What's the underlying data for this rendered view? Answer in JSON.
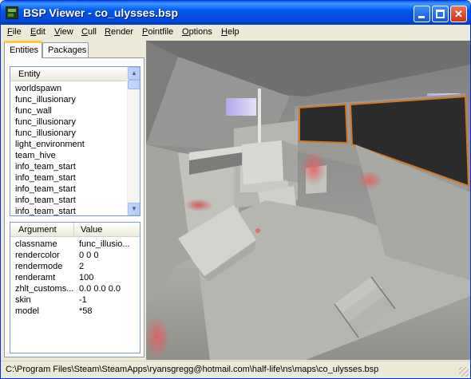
{
  "window": {
    "title": "BSP Viewer - co_ulysses.bsp",
    "controls": {
      "minimize": "minimize",
      "maximize": "maximize",
      "close": "✕"
    }
  },
  "menu": [
    {
      "u": "F",
      "rest": "ile"
    },
    {
      "u": "E",
      "rest": "dit"
    },
    {
      "u": "V",
      "rest": "iew"
    },
    {
      "u": "C",
      "rest": "ull"
    },
    {
      "u": "R",
      "rest": "ender"
    },
    {
      "u": "P",
      "rest": "ointfile"
    },
    {
      "u": "O",
      "rest": "ptions"
    },
    {
      "u": "H",
      "rest": "elp"
    }
  ],
  "tabs": {
    "entities": "Entities",
    "packages": "Packages"
  },
  "entity_list": {
    "header": "Entity",
    "items": [
      "worldspawn",
      "func_illusionary",
      "func_wall",
      "func_illusionary",
      "func_illusionary",
      "light_environment",
      "team_hive",
      "info_team_start",
      "info_team_start",
      "info_team_start",
      "info_team_start",
      "info_team_start"
    ]
  },
  "properties": {
    "headers": {
      "argument": "Argument",
      "value": "Value"
    },
    "rows": [
      {
        "arg": "classname",
        "val": "func_illusio..."
      },
      {
        "arg": "rendercolor",
        "val": "0 0 0"
      },
      {
        "arg": "rendermode",
        "val": "2"
      },
      {
        "arg": "renderamt",
        "val": "100"
      },
      {
        "arg": "zhlt_customs...",
        "val": "0.0 0.0 0.0"
      },
      {
        "arg": "skin",
        "val": "-1"
      },
      {
        "arg": "model",
        "val": "*58"
      }
    ]
  },
  "status": "C:\\Program Files\\Steam\\SteamApps\\ryansgregg@hotmail.com\\half-life\\ns\\maps\\co_ulysses.bsp"
}
